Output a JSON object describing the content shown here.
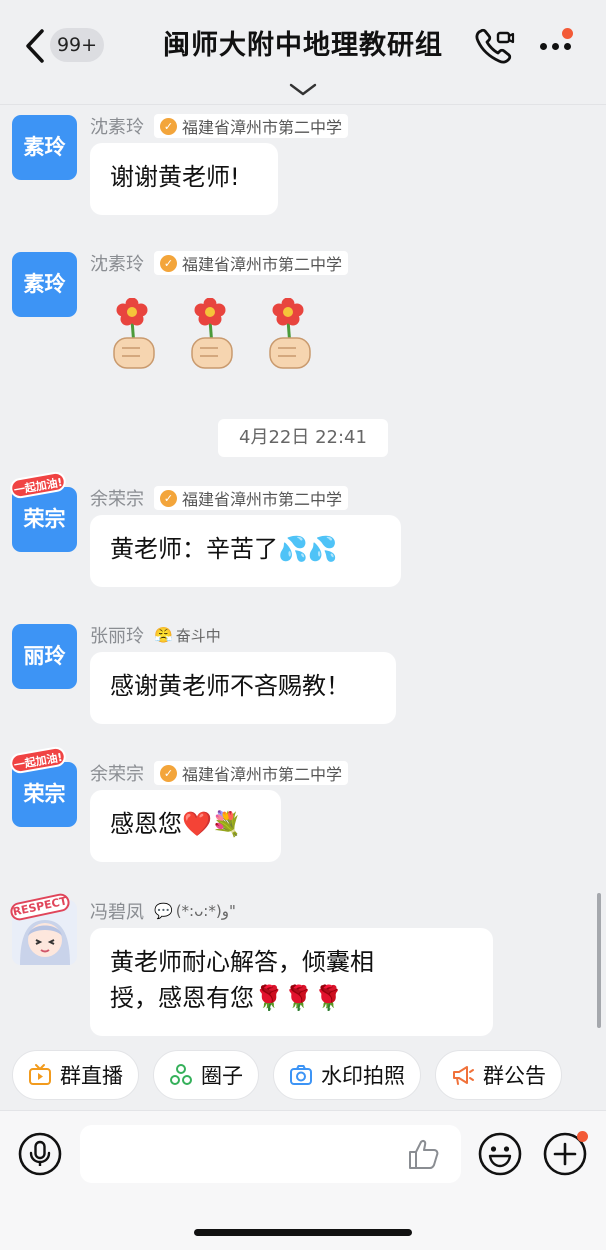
{
  "header": {
    "back_label": "返回",
    "unread_count": "99+",
    "title": "闽师大附中地理教研组"
  },
  "messages": [
    {
      "avatar_text": "素玲",
      "sender": "沈素玲",
      "school": "福建省漳州市第二中学",
      "text": "谢谢黄老师!"
    },
    {
      "avatar_text": "素玲",
      "sender": "沈素玲",
      "school": "福建省漳州市第二中学",
      "text": ""
    },
    {
      "avatar_text": "荣宗",
      "avatar_sticker": "一起加油!",
      "sender": "余荣宗",
      "school": "福建省漳州市第二中学",
      "text": "黄老师：辛苦了💦💦"
    },
    {
      "avatar_text": "丽玲",
      "sender": "张丽玲",
      "status": "奋斗中",
      "text": "感谢黄老师不吝赐教！"
    },
    {
      "avatar_text": "荣宗",
      "avatar_sticker": "一起加油!",
      "sender": "余荣宗",
      "school": "福建省漳州市第二中学",
      "text": "感恩您❤️💐"
    },
    {
      "avatar_sticker": "RESPECT",
      "sender": "冯碧凤",
      "status": "(*:ᴗ:*)و\"",
      "text_line1": "黄老师耐心解答，倾囊相",
      "text_line2": "授，感恩有您🌹🌹🌹"
    }
  ],
  "timestamp": "4月22日 22:41",
  "quick_actions": [
    "群直播",
    "圈子",
    "水印拍照",
    "群公告"
  ],
  "input": {
    "value": "",
    "placeholder": ""
  },
  "colors": {
    "avatar_blue": "#3d94f5",
    "accent_orange": "#f3a53b",
    "notify_red": "#f35a37"
  }
}
